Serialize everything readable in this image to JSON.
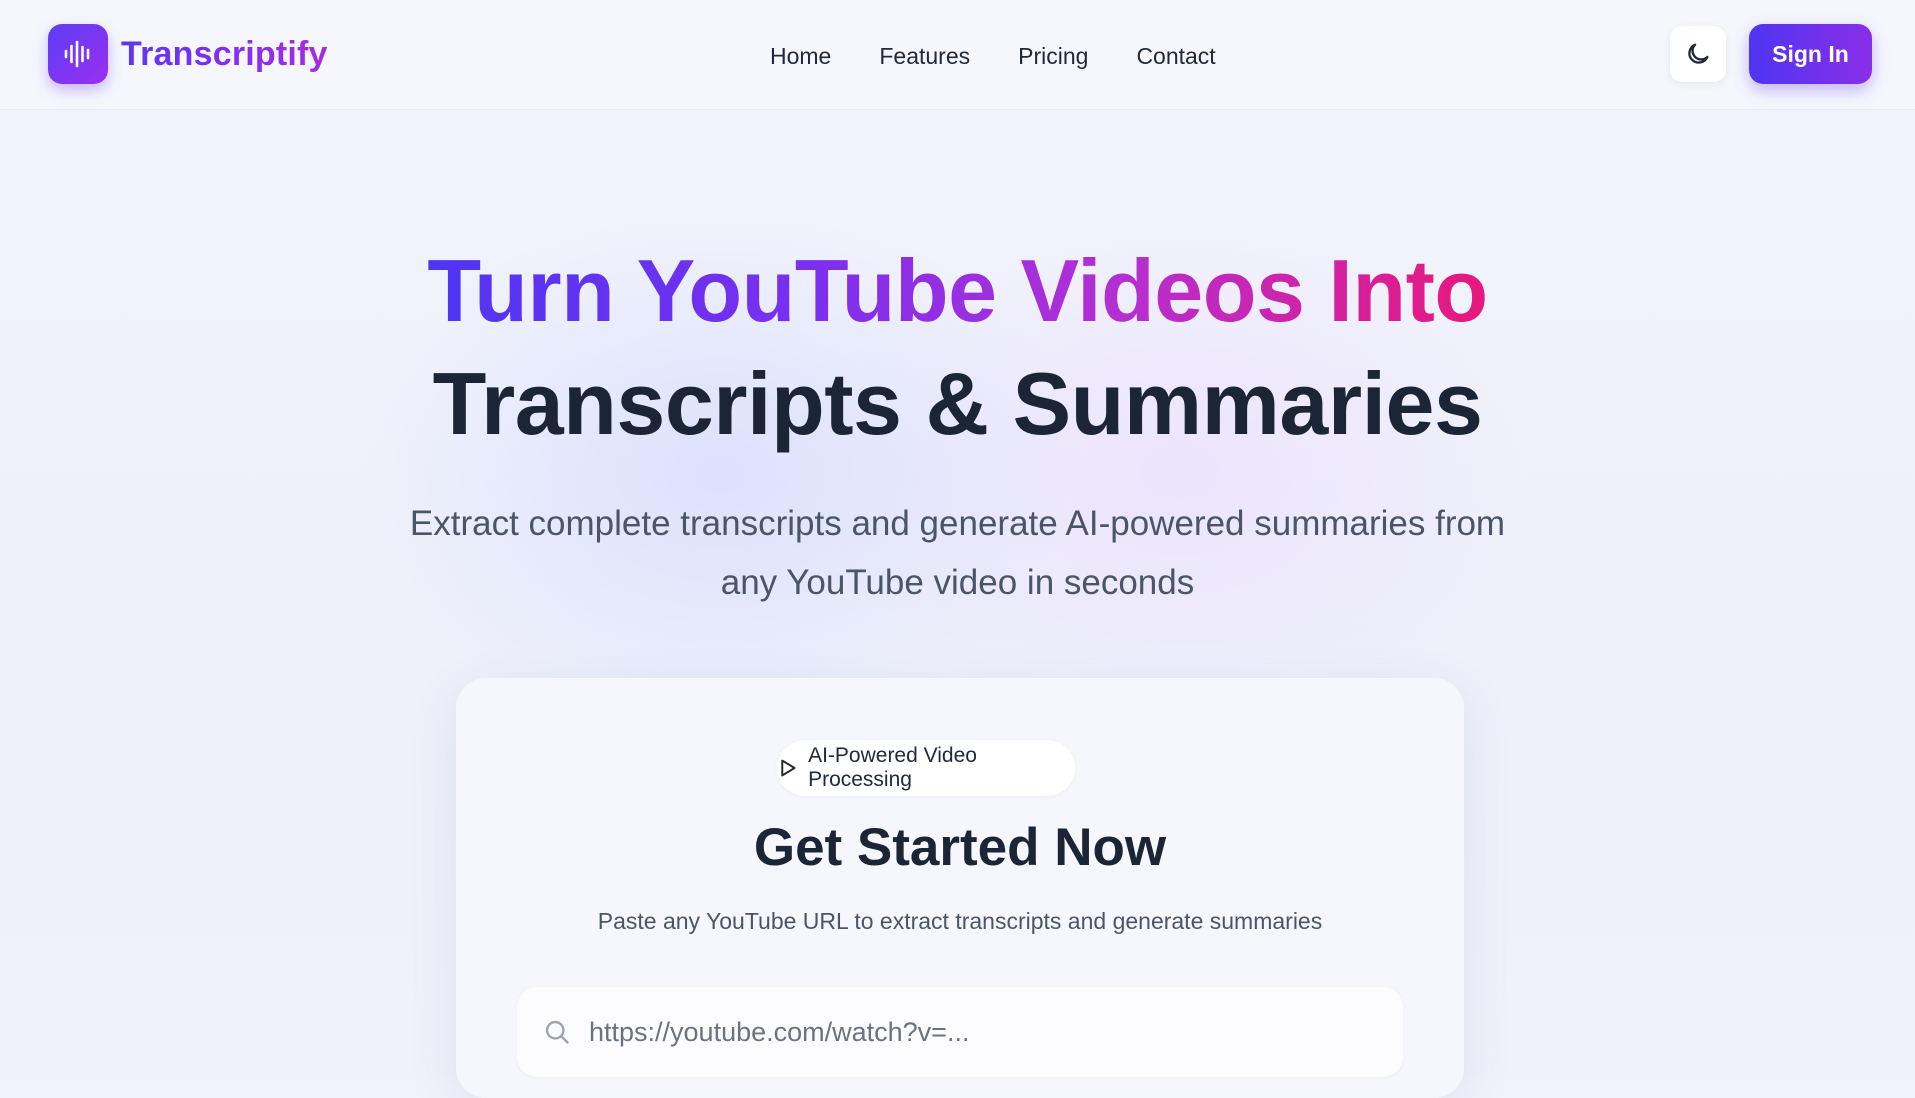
{
  "brand": {
    "name": "Transcriptify",
    "accent": "#5b36f4",
    "accent_secondary": "#8a2ee8",
    "hero_end_color": "#e8187c"
  },
  "nav": {
    "items": [
      {
        "label": "Home"
      },
      {
        "label": "Features"
      },
      {
        "label": "Pricing"
      },
      {
        "label": "Contact"
      }
    ]
  },
  "header": {
    "theme_toggle_icon": "moon-icon",
    "signin_label": "Sign In"
  },
  "hero": {
    "line1": "Turn YouTube Videos Into",
    "line2": "Transcripts & Summaries",
    "subtitle": "Extract complete transcripts and generate AI-powered summaries from any YouTube video in seconds"
  },
  "card": {
    "badge_icon": "play-icon",
    "badge_label": "AI-Powered Video Processing",
    "title": "Get Started Now",
    "subtitle": "Paste any YouTube URL to extract transcripts and generate summaries",
    "url_input": {
      "placeholder": "https://youtube.com/watch?v=...",
      "value": "",
      "icon": "search-icon"
    }
  }
}
